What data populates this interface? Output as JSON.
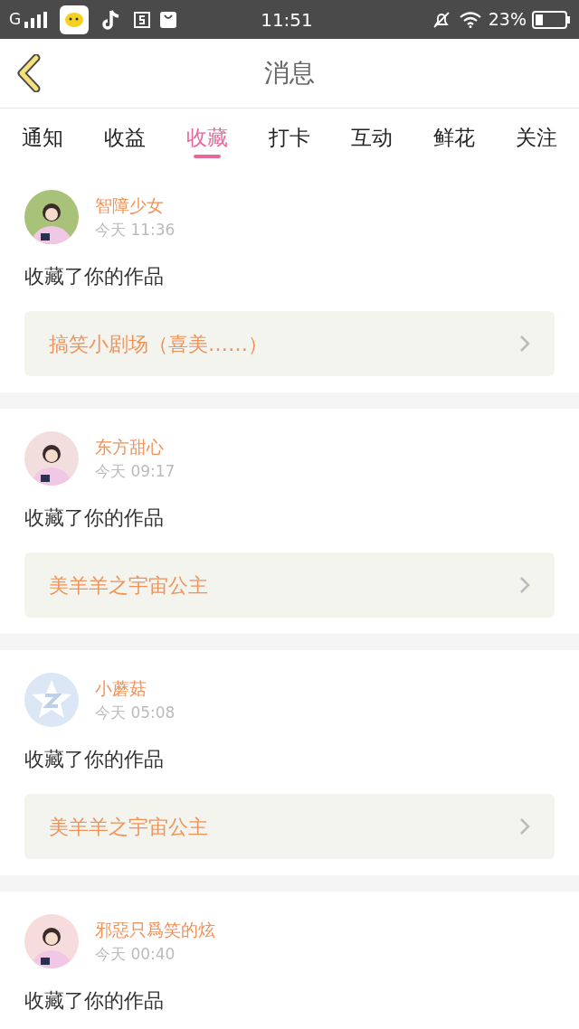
{
  "status_bar": {
    "network": "G",
    "time": "11:51",
    "battery": "23%"
  },
  "header": {
    "title": "消息"
  },
  "tabs": [
    {
      "label": "通知",
      "selected": false
    },
    {
      "label": "收益",
      "selected": false
    },
    {
      "label": "收藏",
      "selected": true
    },
    {
      "label": "打卡",
      "selected": false
    },
    {
      "label": "互动",
      "selected": false
    },
    {
      "label": "鲜花",
      "selected": false
    },
    {
      "label": "关注",
      "selected": false
    }
  ],
  "messages": [
    {
      "name": "智障少女",
      "time": "今天 11:36",
      "action": "收藏了你的作品",
      "work": "搞笑小剧场（喜美……）"
    },
    {
      "name": "东方甜心",
      "time": "今天 09:17",
      "action": "收藏了你的作品",
      "work": "美羊羊之宇宙公主"
    },
    {
      "name": "小蘑菇",
      "time": "今天 05:08",
      "action": "收藏了你的作品",
      "work": "美羊羊之宇宙公主",
      "avatar": {
        "kind": "default"
      }
    },
    {
      "name": "邪惡只爲笑的炫",
      "time": "今天 00:40",
      "action": "收藏了你的作品"
    }
  ]
}
